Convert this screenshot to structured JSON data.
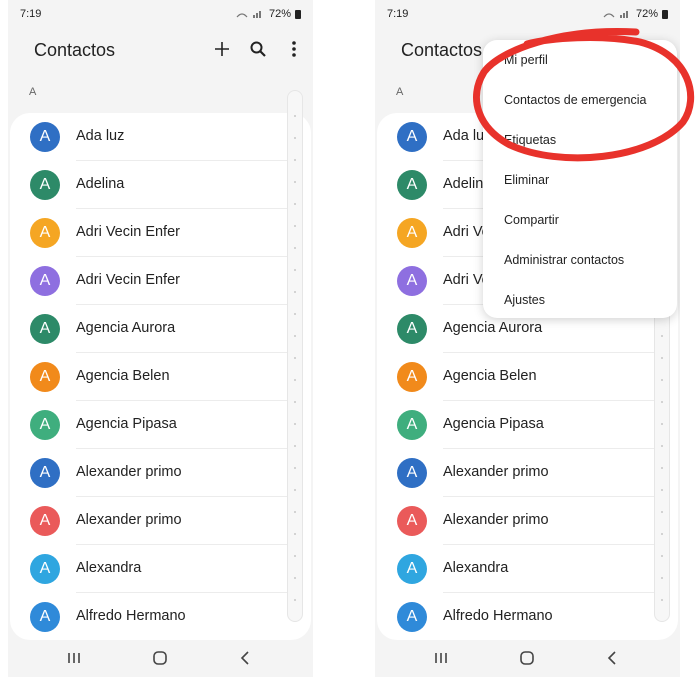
{
  "status": {
    "time": "7:19",
    "battery": "72%"
  },
  "appbar": {
    "title": "Contactos"
  },
  "section_letter": "A",
  "contacts": [
    {
      "initial": "A",
      "name": "Ada luz",
      "color": "#2f6fc4"
    },
    {
      "initial": "A",
      "name": "Adelina",
      "color": "#2d8a68"
    },
    {
      "initial": "A",
      "name": "Adri Vecin Enfer",
      "color": "#f5a623"
    },
    {
      "initial": "A",
      "name": "Adri Vecin Enfer",
      "color": "#8e6fe0"
    },
    {
      "initial": "A",
      "name": "Agencia Aurora",
      "color": "#2d8a68"
    },
    {
      "initial": "A",
      "name": "Agencia Belen",
      "color": "#f18a1b"
    },
    {
      "initial": "A",
      "name": "Agencia Pipasa",
      "color": "#3fae7e"
    },
    {
      "initial": "A",
      "name": "Alexander primo",
      "color": "#2f6fc4"
    },
    {
      "initial": "A",
      "name": "Alexander primo",
      "color": "#ea5a5a"
    },
    {
      "initial": "A",
      "name": "Alexandra",
      "color": "#2fa6e0"
    },
    {
      "initial": "A",
      "name": "Alfredo Hermano",
      "color": "#2f8ad9"
    }
  ],
  "contacts_right": [
    {
      "name": "Ada lu"
    },
    {
      "name": "Adelin"
    },
    {
      "name": "Adri Ve"
    },
    {
      "name": "Adri Ve"
    },
    {
      "name": "Agencia Aurora"
    },
    {
      "name": "Agencia Belen"
    },
    {
      "name": "Agencia Pipasa"
    },
    {
      "name": "Alexander primo"
    },
    {
      "name": "Alexander primo"
    },
    {
      "name": "Alexandra"
    },
    {
      "name": "Alfredo Hermano"
    }
  ],
  "menu": {
    "items": [
      "Mi perfil",
      "Contactos de emergencia",
      "Etiquetas",
      "Eliminar",
      "Compartir",
      "Administrar contactos",
      "Ajustes"
    ]
  },
  "icons": {
    "add": "plus-icon",
    "search": "search-icon",
    "more": "more-vertical-icon",
    "recents": "recents-icon",
    "home": "home-icon",
    "back": "back-icon"
  },
  "annotation_color": "#e8322b"
}
